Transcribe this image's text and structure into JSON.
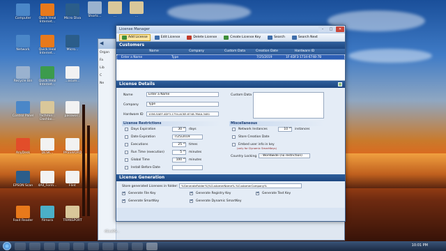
{
  "desktop_icons": [
    {
      "label": "Computer",
      "color": "#4b87c8"
    },
    {
      "label": "Quick Heal Internet...",
      "color": "#e8791b"
    },
    {
      "label": "Micro Diva",
      "color": "#2b5d8a"
    },
    {
      "label": "Shortc...",
      "color": "#9ab2cf"
    },
    {
      "label": "...",
      "color": "#d9c79a"
    },
    {
      "label": "...",
      "color": "#d9c79a"
    },
    {
      "label": "Network",
      "color": "#4b87c8"
    },
    {
      "label": "Quick Heal Internet...",
      "color": "#e8791b"
    },
    {
      "label": "Micro...",
      "color": "#2b5d8a"
    },
    {
      "label": "Recycle Bin",
      "color": "#9ab2cf"
    },
    {
      "label": "Quick Heal Internet...",
      "color": "#3c9b4d"
    },
    {
      "label": "...ocum...",
      "color": "#f2f2f2"
    },
    {
      "label": "Control Panel",
      "color": "#4b87c8"
    },
    {
      "label": "Tachmin... Dashbo...",
      "color": "#d9c79a"
    },
    {
      "label": "passwor...",
      "color": "#f2f2f2"
    },
    {
      "label": "AnyDesk",
      "color": "#e24d2a"
    },
    {
      "label": "DESK...",
      "color": "#f2f2f2"
    },
    {
      "label": "PASSWORD",
      "color": "#f2f2f2"
    },
    {
      "label": "EPSON Scan",
      "color": "#2b5d8a"
    },
    {
      "label": "4All_Form...",
      "color": "#f2f2f2"
    },
    {
      "label": "Flint",
      "color": "#f2f2f2"
    },
    {
      "label": "Foxit Reader",
      "color": "#e8791b"
    },
    {
      "label": "filmora",
      "color": "#4bb0c8"
    },
    {
      "label": "TRANSPORT",
      "color": "#d9c79a"
    }
  ],
  "explorer": {
    "organize_label": "Organ",
    "side_labels": [
      "Fa",
      "Lib",
      "C",
      "Ne"
    ]
  },
  "window": {
    "title": "License Manager",
    "toolbar": [
      {
        "label": "Add License",
        "active": true,
        "color": "#3f8f3a"
      },
      {
        "label": "Edit License",
        "active": false,
        "color": "#3e6eab"
      },
      {
        "label": "Delete License",
        "active": false,
        "color": "#c23a2a"
      },
      {
        "label": "Create License Key",
        "active": false,
        "color": "#3f8f3a"
      },
      {
        "label": "Search",
        "active": false,
        "color": "#3e6eab"
      },
      {
        "label": "Search Next",
        "active": false,
        "color": "#3e6eab"
      }
    ]
  },
  "customers": {
    "section_title": "Customers",
    "columns": [
      "Name",
      "Company",
      "Custom Data",
      "Creation Date",
      "Hardware ID"
    ],
    "rows": [
      {
        "name": "Enter a Name",
        "company": "Type",
        "custom": "",
        "date": "7/25/2019",
        "hwid": "1F-4DF3-1734-6748-7B"
      }
    ]
  },
  "license_details": {
    "section_title": "License Details",
    "name_label": "Name",
    "name_value": "Enter a Name",
    "company_label": "Company",
    "company_value": "Type",
    "hwid_label": "Hardware ID",
    "hwid_value": "1056-5AEF-4DF3-1734-ACB3-6748-7BAA-3481",
    "custom_label": "Custom Data",
    "custom_value": "",
    "restrictions_title": "License Restrictions",
    "restrictions": [
      {
        "label": "Days Expiration",
        "value": "30",
        "unit": "days",
        "checked": false,
        "type": "spin"
      },
      {
        "label": "Date Expiration",
        "value": "7/25/2019",
        "unit": "",
        "checked": false,
        "type": "date"
      },
      {
        "label": "Executions",
        "value": "25",
        "unit": "times",
        "checked": false,
        "type": "spin"
      },
      {
        "label": "Run Time (execution)",
        "value": "5",
        "unit": "minutes",
        "checked": false,
        "type": "spin"
      },
      {
        "label": "Global Time",
        "value": "100",
        "unit": "minutes",
        "checked": false,
        "type": "spin"
      },
      {
        "label": "Install Before Date",
        "value": "",
        "unit": "",
        "checked": false,
        "type": "date"
      }
    ],
    "misc_title": "Miscellaneous",
    "misc": [
      {
        "label": "Network Instances",
        "value": "10",
        "unit": "instances",
        "checked": false
      },
      {
        "label": "Store Creation Date",
        "checked": false
      },
      {
        "label": "Embed user info in key",
        "checked": false
      }
    ],
    "embed_note": "(only for Dynamic SmartKeys)",
    "country_label": "Country Locking",
    "country_value": "- Worldwide (no restriction)"
  },
  "license_generation": {
    "section_title": "License Generation",
    "store_label": "Store generated Licenses in folder:",
    "store_value": "%GenerateFolder%\\%CustomerName%-%CustomerCompany%",
    "options": [
      {
        "label": "Generate File Key",
        "checked": true
      },
      {
        "label": "Generate Registry Key",
        "checked": true
      },
      {
        "label": "Generate Text Key",
        "checked": true
      },
      {
        "label": "Generate SmartKey",
        "checked": true
      },
      {
        "label": "Generate Dynamic SmartKey",
        "checked": true
      }
    ]
  },
  "taskbar": {
    "clock": "10:01 PM",
    "file_label": "d1su05..."
  }
}
